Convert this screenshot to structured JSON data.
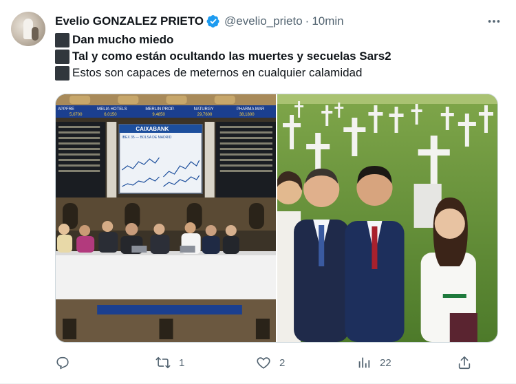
{
  "author": {
    "name": "Evelio GONZALEZ PRIETO",
    "handle": "@evelio_prieto",
    "separator": "·",
    "time": "10min",
    "verified_color": "#1d9bf0"
  },
  "tweet": {
    "lines": [
      "Dan mucho miedo",
      "Tal y como están ocultando las muertes y secuelas Sars2",
      "Estos son capaces de meternos en cualquier calamidad"
    ]
  },
  "media": {
    "left_image": "tv studio panel at stock exchange",
    "right_image": "politicians in front of cemetery crosses",
    "ticker_labels": [
      "APPFRE",
      "MELIA HOTELS",
      "MERLIN PROP.",
      "NATURGY",
      "PHARMA MAR"
    ],
    "ticker_values": [
      "5,0700",
      "6,0150",
      "9,4850",
      "29,7600",
      "38,1800"
    ],
    "screen_title": "CAIXABANK",
    "screen_subtitle": "IBEX 35 — BOLSA DE MADRID"
  },
  "actions": {
    "reply_icon": "reply-icon",
    "retweet_count": "1",
    "like_count": "2",
    "views_count": "22"
  }
}
